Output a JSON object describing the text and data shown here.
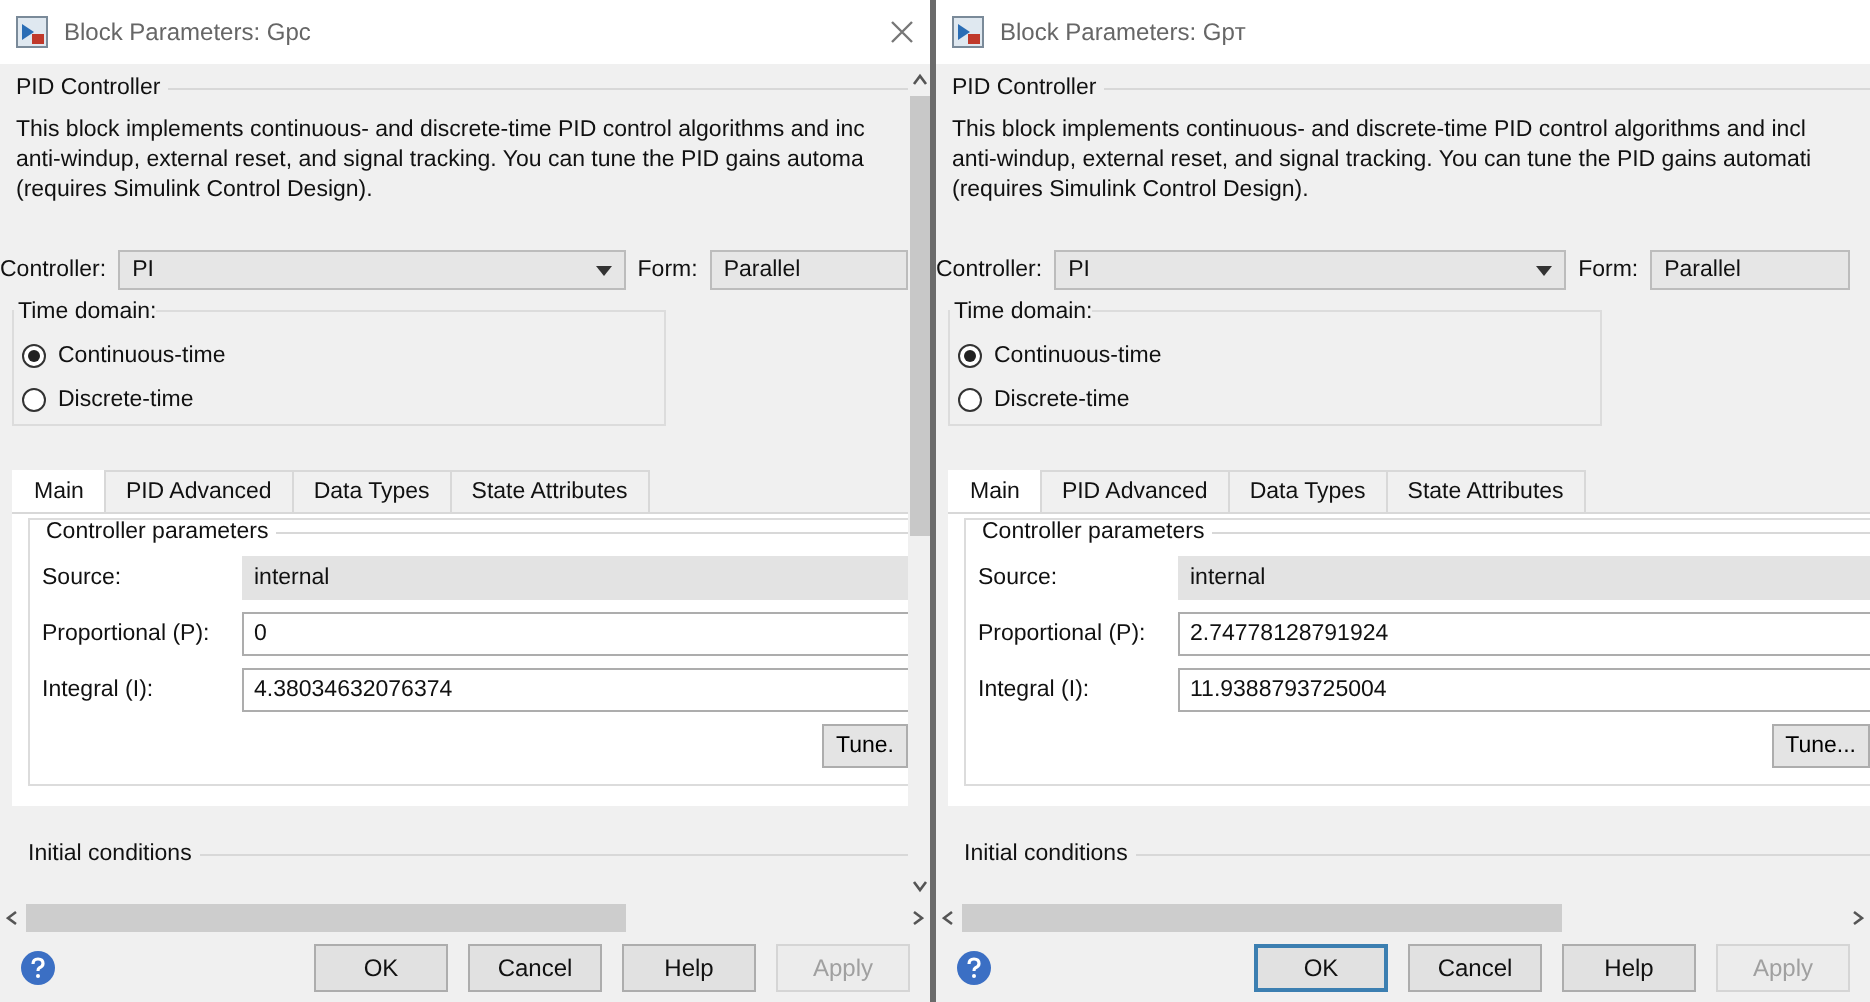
{
  "dialogs": [
    {
      "title": "Block Parameters: Gpc",
      "close_visible": true,
      "vertical_scrollbar": true,
      "block_name": "PID Controller",
      "description": [
        "This block implements continuous- and discrete-time PID control algorithms and inc",
        "anti-windup, external reset, and signal tracking. You can tune the PID gains automa",
        "(requires Simulink Control Design)."
      ],
      "controller_label": "Controller:",
      "controller_value": "PI",
      "form_label": "Form:",
      "form_value": "Parallel",
      "time_domain_label": "Time domain:",
      "time_domains": [
        {
          "label": "Continuous-time",
          "selected": true
        },
        {
          "label": "Discrete-time",
          "selected": false
        }
      ],
      "tabs": [
        {
          "label": "Main",
          "selected": true
        },
        {
          "label": "PID Advanced",
          "selected": false
        },
        {
          "label": "Data Types",
          "selected": false
        },
        {
          "label": "State Attributes",
          "selected": false
        }
      ],
      "params_label": "Controller parameters",
      "params": [
        {
          "label": "Source:",
          "value": "internal",
          "disabled": true
        },
        {
          "label": "Proportional (P):",
          "value": "0",
          "disabled": false
        },
        {
          "label": "Integral (I):",
          "value": "4.38034632076374",
          "disabled": false
        }
      ],
      "tune": "Tune.",
      "initial_label": "Initial conditions",
      "buttons": [
        {
          "label": "OK",
          "focused": false,
          "disabled": false
        },
        {
          "label": "Cancel",
          "focused": false,
          "disabled": false
        },
        {
          "label": "Help",
          "focused": false,
          "disabled": false
        },
        {
          "label": "Apply",
          "focused": false,
          "disabled": true
        }
      ]
    },
    {
      "title": "Block Parameters: Gpт",
      "close_visible": false,
      "vertical_scrollbar": false,
      "block_name": "PID Controller",
      "description": [
        "This block implements continuous- and discrete-time PID control algorithms and incl",
        "anti-windup, external reset, and signal tracking. You can tune the PID gains automati",
        "(requires Simulink Control Design)."
      ],
      "controller_label": "Controller:",
      "controller_value": "PI",
      "form_label": "Form:",
      "form_value": "Parallel",
      "time_domain_label": "Time domain:",
      "time_domains": [
        {
          "label": "Continuous-time",
          "selected": true
        },
        {
          "label": "Discrete-time",
          "selected": false
        }
      ],
      "tabs": [
        {
          "label": "Main",
          "selected": true
        },
        {
          "label": "PID Advanced",
          "selected": false
        },
        {
          "label": "Data Types",
          "selected": false
        },
        {
          "label": "State Attributes",
          "selected": false
        }
      ],
      "params_label": "Controller parameters",
      "params": [
        {
          "label": "Source:",
          "value": "internal",
          "disabled": true
        },
        {
          "label": "Proportional (P):",
          "value": "2.74778128791924",
          "disabled": false
        },
        {
          "label": "Integral (I):",
          "value": "11.9388793725004",
          "disabled": false
        }
      ],
      "tune": "Tune...",
      "initial_label": "Initial conditions",
      "buttons": [
        {
          "label": "OK",
          "focused": true,
          "disabled": false
        },
        {
          "label": "Cancel",
          "focused": false,
          "disabled": false
        },
        {
          "label": "Help",
          "focused": false,
          "disabled": false
        },
        {
          "label": "Apply",
          "focused": false,
          "disabled": true
        }
      ]
    }
  ]
}
